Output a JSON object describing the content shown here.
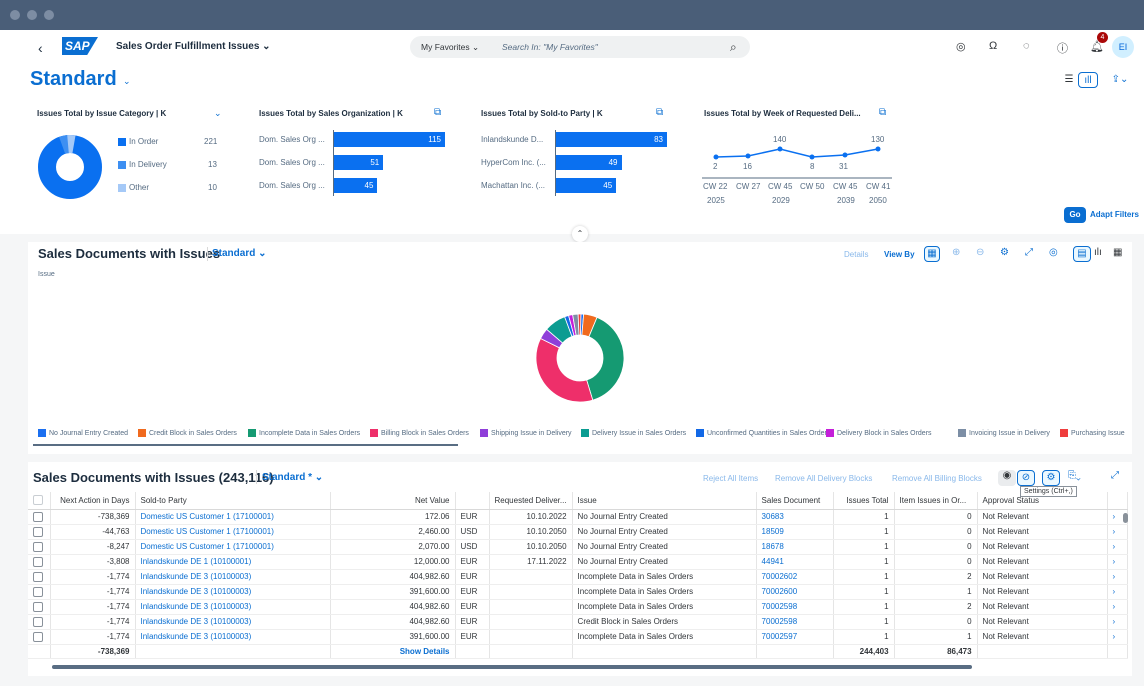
{
  "shell": {
    "back_icon": "chevron-left",
    "logo": "SAP",
    "app_title": "Sales Order Fulfillment Issues",
    "search_scope": "My Favorites",
    "search_placeholder": "Search In: \"My Favorites\"",
    "notification_count": "4",
    "avatar_initials": "EI"
  },
  "header": {
    "variant": "Standard",
    "go_label": "Go",
    "adapt_filters_label": "Adapt Filters"
  },
  "kpi_cards": [
    {
      "title": "Issues Total by Issue Category  | K",
      "legend": [
        {
          "label": "In Order",
          "value": "221",
          "color": "#0a70f0"
        },
        {
          "label": "In Delivery",
          "value": "13",
          "color": "#3d8ff2"
        },
        {
          "label": "Other",
          "value": "10",
          "color": "#a5c9f7"
        }
      ]
    },
    {
      "title": "Issues Total by Sales Organization  | K",
      "bars": [
        {
          "label": "Dom. Sales Org ...",
          "value": 115
        },
        {
          "label": "Dom. Sales Org ...",
          "value": 51
        },
        {
          "label": "Dom. Sales Org ...",
          "value": 45
        }
      ]
    },
    {
      "title": "Issues Total by Sold-to Party  | K",
      "bars": [
        {
          "label": "Inlandskunde D...",
          "value": 83
        },
        {
          "label": "HyperCom Inc. (...",
          "value": 49
        },
        {
          "label": "Machattan Inc. (...",
          "value": 45
        }
      ]
    },
    {
      "title": "Issues Total by Week of Requested Deli...",
      "points": [
        {
          "label": "2",
          "week": "CW 22",
          "year": "2025"
        },
        {
          "label": "16",
          "week": "CW 27",
          "year": ""
        },
        {
          "label": "140",
          "week": "CW 45",
          "year": "2029"
        },
        {
          "label": "8",
          "week": "CW 50",
          "year": ""
        },
        {
          "label": "31",
          "week": "CW 45",
          "year": "2039"
        },
        {
          "label": "130",
          "week": "CW 41",
          "year": "2050"
        }
      ]
    }
  ],
  "chart_section": {
    "title": "Sales Documents with Issues",
    "variant": "Standard",
    "dimension_label": "Issue",
    "details_label": "Details",
    "view_by_label": "View By"
  },
  "chart_data": {
    "type": "pie",
    "title": "Sales Documents with Issues",
    "subtitle": "Issue",
    "legend_position": "bottom",
    "categories": [
      "No Journal Entry Created",
      "Credit Block in Sales Orders",
      "Incomplete Data in Sales Orders",
      "Billing Block in Sales Orders",
      "Shipping Issue in Delivery",
      "Delivery Issue in Sales Orders",
      "Unconfirmed Quantities in Sales Orders",
      "Delivery Block in Sales Orders",
      "Invoicing Issue in Delivery",
      "Purchasing Issue"
    ],
    "values": [
      1,
      5,
      39,
      37,
      4,
      8,
      1.5,
      1.5,
      2,
      1
    ],
    "colors": [
      "#1b6ff0",
      "#f06a1e",
      "#159a72",
      "#ee2f6a",
      "#8f3ed9",
      "#0b9c91",
      "#1268e6",
      "#c41fd9",
      "#7c8ea5",
      "#ef3d3d"
    ]
  },
  "table": {
    "title": "Sales Documents with Issues (243,116)",
    "variant": "Standard *",
    "actions": [
      "Reject All Items",
      "Remove All Delivery Blocks",
      "Remove All Billing Blocks"
    ],
    "tooltip": "Settings (Ctrl+,)",
    "columns": [
      "Next Action in Days",
      "Sold-to Party",
      "Net Value",
      "Requested Deliver...",
      "Issue",
      "Sales Document",
      "Issues Total",
      "Item Issues in Or...",
      "Approval Status"
    ],
    "rows": [
      {
        "days": "-738,369",
        "party": "Domestic US Customer 1 (17100001)",
        "net": "172.06",
        "cur": "EUR",
        "date": "10.10.2022",
        "issue": "No Journal Entry Created",
        "doc": "30683",
        "total": "1",
        "items": "0",
        "status": "Not Relevant"
      },
      {
        "days": "-44,763",
        "party": "Domestic US Customer 1 (17100001)",
        "net": "2,460.00",
        "cur": "USD",
        "date": "10.10.2050",
        "issue": "No Journal Entry Created",
        "doc": "18509",
        "total": "1",
        "items": "0",
        "status": "Not Relevant"
      },
      {
        "days": "-8,247",
        "party": "Domestic US Customer 1 (17100001)",
        "net": "2,070.00",
        "cur": "USD",
        "date": "10.10.2050",
        "issue": "No Journal Entry Created",
        "doc": "18678",
        "total": "1",
        "items": "0",
        "status": "Not Relevant"
      },
      {
        "days": "-3,808",
        "party": "Inlandskunde DE 1 (10100001)",
        "net": "12,000.00",
        "cur": "EUR",
        "date": "17.11.2022",
        "issue": "No Journal Entry Created",
        "doc": "44941",
        "total": "1",
        "items": "0",
        "status": "Not Relevant"
      },
      {
        "days": "-1,774",
        "party": "Inlandskunde DE 3 (10100003)",
        "net": "404,982.60",
        "cur": "EUR",
        "date": "",
        "issue": "Incomplete Data in Sales Orders",
        "doc": "70002602",
        "total": "1",
        "items": "2",
        "status": "Not Relevant"
      },
      {
        "days": "-1,774",
        "party": "Inlandskunde DE 3 (10100003)",
        "net": "391,600.00",
        "cur": "EUR",
        "date": "",
        "issue": "Incomplete Data in Sales Orders",
        "doc": "70002600",
        "total": "1",
        "items": "1",
        "status": "Not Relevant"
      },
      {
        "days": "-1,774",
        "party": "Inlandskunde DE 3 (10100003)",
        "net": "404,982.60",
        "cur": "EUR",
        "date": "",
        "issue": "Incomplete Data in Sales Orders",
        "doc": "70002598",
        "total": "1",
        "items": "2",
        "status": "Not Relevant"
      },
      {
        "days": "-1,774",
        "party": "Inlandskunde DE 3 (10100003)",
        "net": "404,982.60",
        "cur": "EUR",
        "date": "",
        "issue": "Credit Block in Sales Orders",
        "doc": "70002598",
        "total": "1",
        "items": "0",
        "status": "Not Relevant"
      },
      {
        "days": "-1,774",
        "party": "Inlandskunde DE 3 (10100003)",
        "net": "391,600.00",
        "cur": "EUR",
        "date": "",
        "issue": "Incomplete Data in Sales Orders",
        "doc": "70002597",
        "total": "1",
        "items": "1",
        "status": "Not Relevant"
      }
    ],
    "totals": {
      "days": "-738,369",
      "show_details": "Show Details",
      "total": "244,403",
      "items": "86,473"
    }
  }
}
